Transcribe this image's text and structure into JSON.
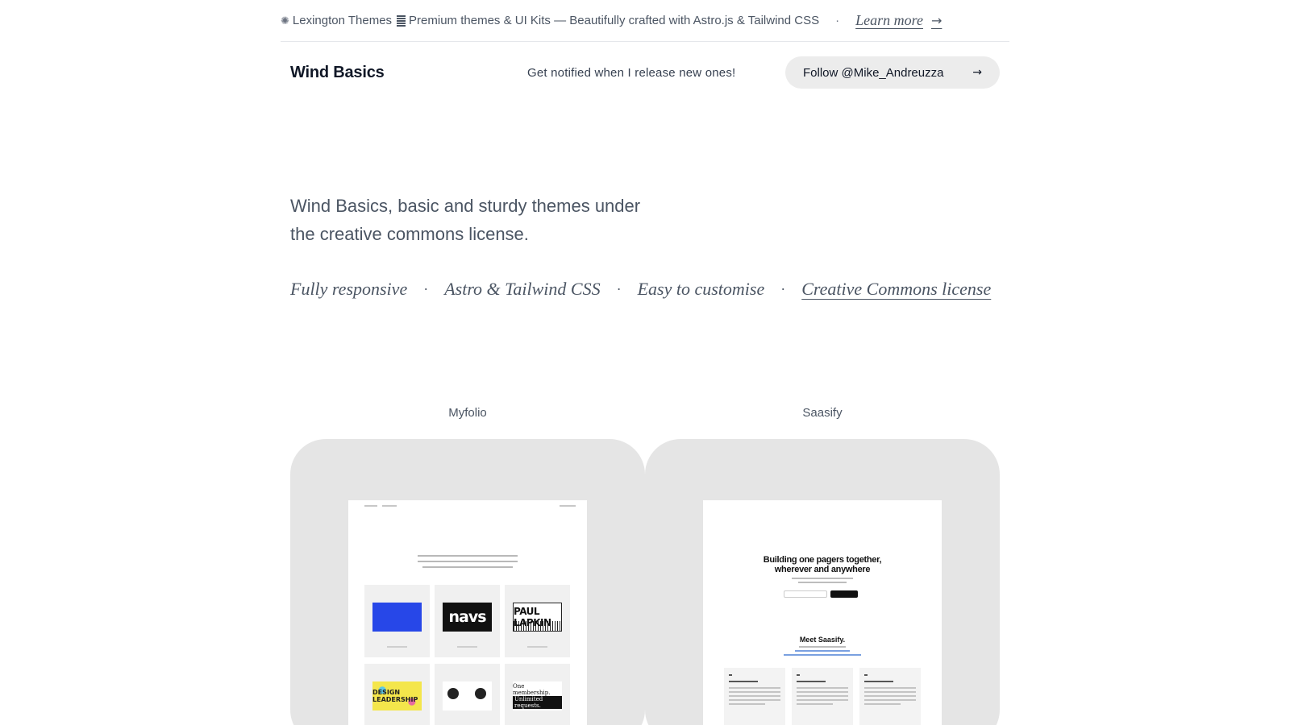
{
  "announcement": {
    "brand_icon": "✺",
    "brand": "Lexington Themes",
    "icon_name": "bars-icon",
    "text": "Premium themes & UI Kits — Beautifully crafted with Astro.js & Tailwind CSS",
    "separator": "·",
    "learn_more": "Learn more",
    "arrow": "→"
  },
  "header": {
    "logo": "Wind Basics",
    "notify": "Get notified when I release new ones!",
    "follow_label": "Follow @Mike_Andreuzza",
    "follow_arrow": "→"
  },
  "hero": {
    "tagline": "Wind Basics, basic and sturdy themes under the creative commons license."
  },
  "features": {
    "items": [
      "Fully responsive",
      "Astro & Tailwind CSS",
      "Easy to customise",
      "Creative Commons license"
    ],
    "separator": "·"
  },
  "cards": [
    {
      "label": "Myfolio",
      "thumb_texts": [
        "navs",
        "PAUL LAPKIN",
        "DESIGN LEADERSHIP",
        "One membership.",
        "Unlimited requests."
      ]
    },
    {
      "label": "Saasify",
      "thumb_texts": [
        "Building one pagers together, wherever and anywhere",
        "Meet Saasify."
      ]
    }
  ],
  "colors": {
    "card_bg": "#e5e5e5",
    "button_bg": "#ececec",
    "text_muted": "#4b5563"
  }
}
